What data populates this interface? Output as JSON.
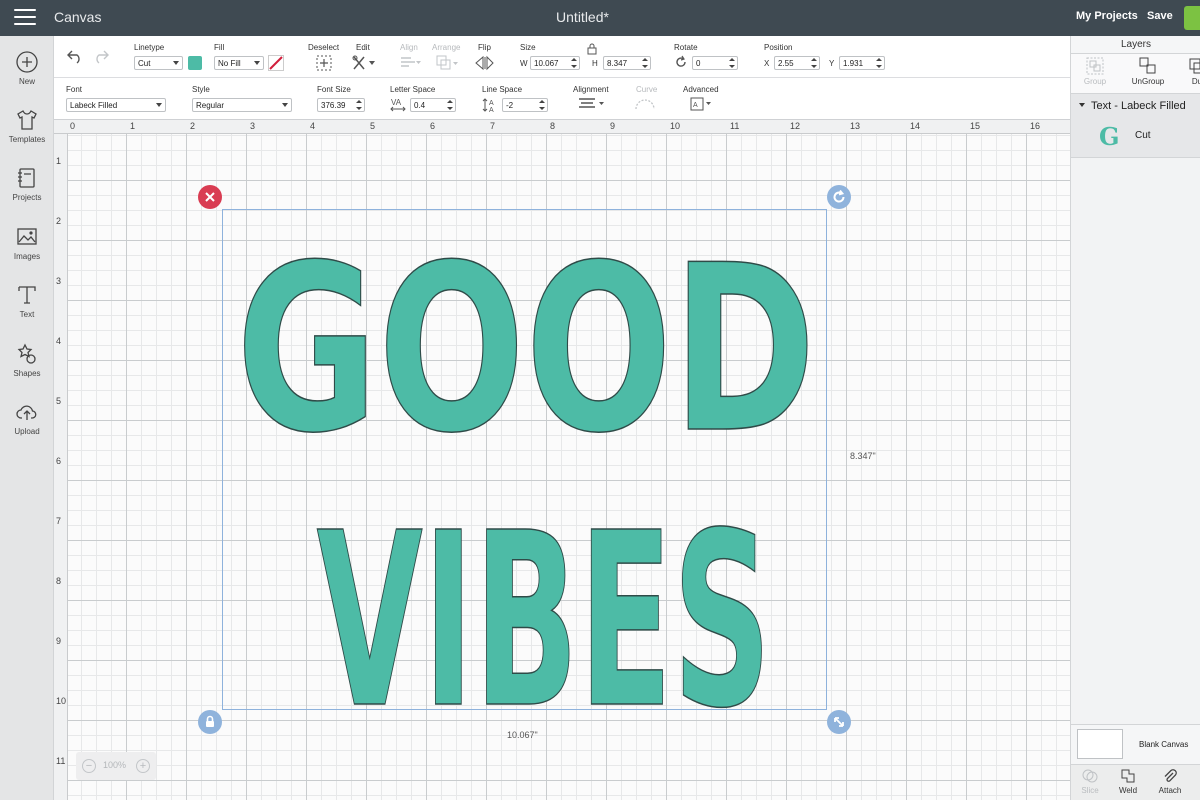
{
  "app": {
    "name": "Canvas",
    "doc_title": "Untitled*",
    "my_projects": "My Projects",
    "save": "Save"
  },
  "sidebar": {
    "items": [
      {
        "label": "New",
        "icon": "plus-circle-icon"
      },
      {
        "label": "Templates",
        "icon": "tshirt-icon"
      },
      {
        "label": "Projects",
        "icon": "notebook-icon"
      },
      {
        "label": "Images",
        "icon": "image-icon"
      },
      {
        "label": "Text",
        "icon": "text-t-icon"
      },
      {
        "label": "Shapes",
        "icon": "shapes-icon"
      },
      {
        "label": "Upload",
        "icon": "cloud-upload-icon"
      }
    ]
  },
  "toolbar": {
    "linetype_label": "Linetype",
    "linetype_value": "Cut",
    "fill_label": "Fill",
    "fill_value": "No Fill",
    "fill_color": "#4dbba6",
    "deselect_label": "Deselect",
    "edit_label": "Edit",
    "align_label": "Align",
    "arrange_label": "Arrange",
    "flip_label": "Flip",
    "size_label": "Size",
    "w_label": "W",
    "w_value": "10.067",
    "h_label": "H",
    "h_value": "8.347",
    "rotate_label": "Rotate",
    "rotate_value": "0",
    "position_label": "Position",
    "x_label": "X",
    "x_value": "2.55",
    "y_label": "Y",
    "y_value": "1.931"
  },
  "text_toolbar": {
    "font_label": "Font",
    "font_value": "Labeck Filled",
    "style_label": "Style",
    "style_value": "Regular",
    "font_size_label": "Font Size",
    "font_size_value": "376.39",
    "letter_space_label": "Letter Space",
    "letter_space_value": "0.4",
    "line_space_label": "Line Space",
    "line_space_value": "-2",
    "alignment_label": "Alignment",
    "curve_label": "Curve",
    "advanced_label": "Advanced"
  },
  "canvas": {
    "ruler_h": [
      "0",
      "1",
      "2",
      "3",
      "4",
      "5",
      "6",
      "7",
      "8",
      "9",
      "10",
      "11",
      "12",
      "13",
      "14",
      "15",
      "16"
    ],
    "ruler_v": [
      "1",
      "2",
      "3",
      "4",
      "5",
      "6",
      "7",
      "8",
      "9",
      "10",
      "11"
    ],
    "text_line1": "GOOD",
    "text_line2": "VIBES",
    "text_color": "#4dbba6",
    "width_label": "10.067\"",
    "height_label": "8.347\"",
    "zoom": "100%"
  },
  "layers": {
    "title": "Layers",
    "tools": [
      "Group",
      "UnGroup",
      "Du"
    ],
    "group_name": "Text - Labeck Filled",
    "item_glyph": "G",
    "item_name": "Cut",
    "blank_canvas": "Blank Canvas",
    "bottom_tools": [
      "Slice",
      "Weld",
      "Attach"
    ]
  }
}
